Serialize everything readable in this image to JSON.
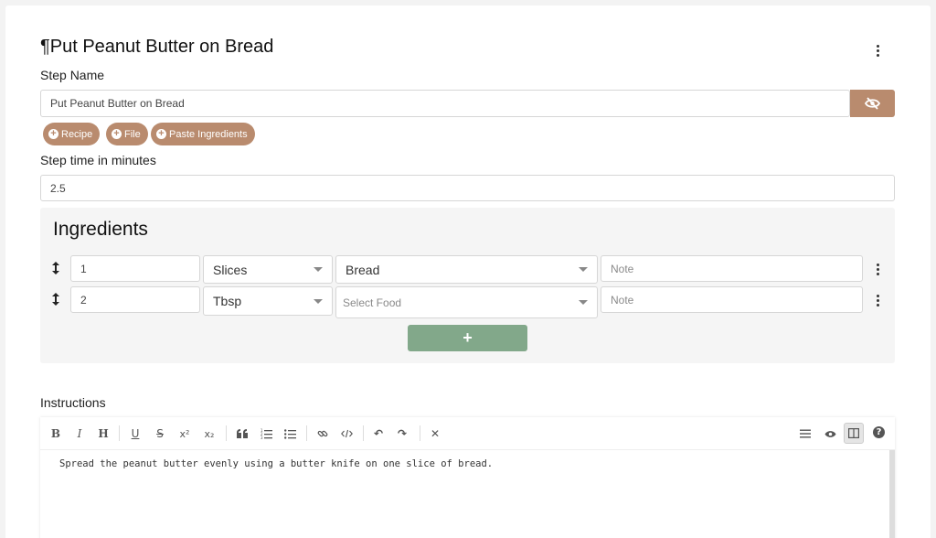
{
  "step": {
    "title": "¶Put Peanut Butter on Bread",
    "name_label": "Step Name",
    "name_value": "Put Peanut Butter on Bread",
    "buttons": {
      "recipe": "Recipe",
      "file": "File",
      "paste": "Paste Ingredients"
    },
    "time_label": "Step time in minutes",
    "time_value": "2.5"
  },
  "ingredients": {
    "title": "Ingredients",
    "rows": [
      {
        "amount": "1",
        "unit": "Slices",
        "food": "Bread",
        "food_placeholder": false,
        "note_placeholder": "Note"
      },
      {
        "amount": "2",
        "unit": "Tbsp",
        "food": "Select Food",
        "food_placeholder": true,
        "note_placeholder": "Note"
      }
    ],
    "add_label": "+"
  },
  "instructions": {
    "label": "Instructions",
    "text": "Spread the peanut butter evenly using a butter knife on one slice of bread.",
    "toolbar": {
      "bold": "B",
      "italic": "I",
      "heading": "H",
      "underline": "U",
      "strike": "S",
      "superscript": "x²",
      "subscript": "x₂",
      "undo": "↶",
      "redo": "↷",
      "clear": "✕",
      "help": "?"
    }
  },
  "colors": {
    "accent": "#b98b6e",
    "add": "#82a88a",
    "panel": "#f5f5f5"
  }
}
